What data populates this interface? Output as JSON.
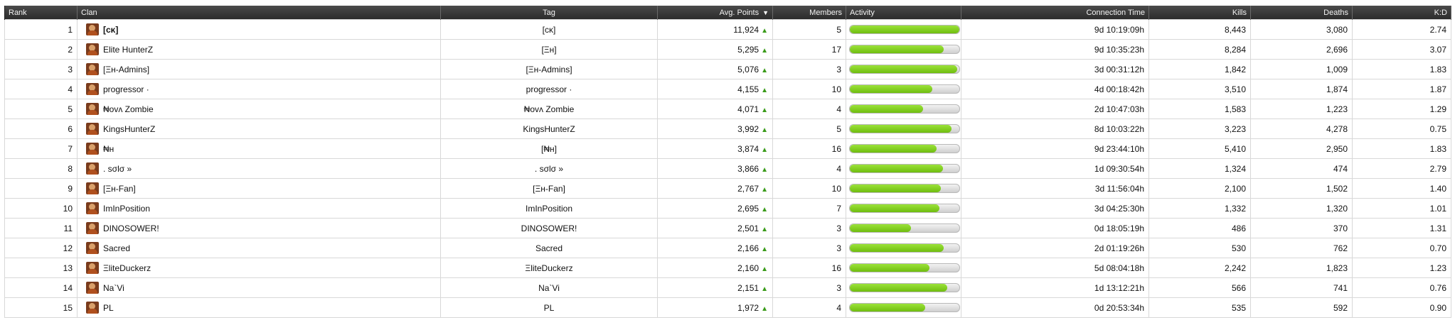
{
  "columns": {
    "rank": "Rank",
    "clan": "Clan",
    "tag": "Tag",
    "avg_points": "Avg. Points",
    "members": "Members",
    "activity": "Activity",
    "connection_time": "Connection Time",
    "kills": "Kills",
    "deaths": "Deaths",
    "kd": "K:D"
  },
  "sort_icon": "triangle-down-icon",
  "colors": {
    "header_bg": "#333333",
    "activity_bar": "#7ccf1c",
    "up_arrow": "#3a9b1a"
  },
  "rows": [
    {
      "rank": "1",
      "clan": "[ᴄᴋ]",
      "clan_bold": true,
      "tag": "[ᴄᴋ]",
      "avg_points": "11,924",
      "members": "5",
      "activity": 1.0,
      "connection_time": "9d 10:19:09h",
      "kills": "8,443",
      "deaths": "3,080",
      "kd": "2.74"
    },
    {
      "rank": "2",
      "clan": "Elite HunterZ",
      "tag": "[Ξн]",
      "avg_points": "5,295",
      "members": "17",
      "activity": 0.86,
      "connection_time": "9d 10:35:23h",
      "kills": "8,284",
      "deaths": "2,696",
      "kd": "3.07"
    },
    {
      "rank": "3",
      "clan": "[Ξн-Admins]",
      "tag": "[Ξн-Admins]",
      "avg_points": "5,076",
      "members": "3",
      "activity": 0.98,
      "connection_time": "3d 00:31:12h",
      "kills": "1,842",
      "deaths": "1,009",
      "kd": "1.83"
    },
    {
      "rank": "4",
      "clan": "progressor ·",
      "tag": "progressor ·",
      "avg_points": "4,155",
      "members": "10",
      "activity": 0.75,
      "connection_time": "4d 00:18:42h",
      "kills": "3,510",
      "deaths": "1,874",
      "kd": "1.87"
    },
    {
      "rank": "5",
      "clan": "₦ovʌ Zombie",
      "tag": "₦ovʌ Zombie",
      "avg_points": "4,071",
      "members": "4",
      "activity": 0.67,
      "connection_time": "2d 10:47:03h",
      "kills": "1,583",
      "deaths": "1,223",
      "kd": "1.29"
    },
    {
      "rank": "6",
      "clan": "KingsHunterZ",
      "tag": "KingsHunterZ",
      "avg_points": "3,992",
      "members": "5",
      "activity": 0.93,
      "connection_time": "8d 10:03:22h",
      "kills": "3,223",
      "deaths": "4,278",
      "kd": "0.75"
    },
    {
      "rank": "7",
      "clan": "₦н",
      "tag": "[₦н]",
      "avg_points": "3,874",
      "members": "16",
      "activity": 0.79,
      "connection_time": "9d 23:44:10h",
      "kills": "5,410",
      "deaths": "2,950",
      "kd": "1.83"
    },
    {
      "rank": "8",
      "clan": ". sσlσ »",
      "tag": ". sσlσ »",
      "avg_points": "3,866",
      "members": "4",
      "activity": 0.85,
      "connection_time": "1d 09:30:54h",
      "kills": "1,324",
      "deaths": "474",
      "kd": "2.79"
    },
    {
      "rank": "9",
      "clan": "[Ξн-Fan]",
      "tag": "[Ξн-Fan]",
      "avg_points": "2,767",
      "members": "10",
      "activity": 0.83,
      "connection_time": "3d 11:56:04h",
      "kills": "2,100",
      "deaths": "1,502",
      "kd": "1.40"
    },
    {
      "rank": "10",
      "clan": "ImInPosition",
      "tag": "ImInPosition",
      "avg_points": "2,695",
      "members": "7",
      "activity": 0.82,
      "connection_time": "3d 04:25:30h",
      "kills": "1,332",
      "deaths": "1,320",
      "kd": "1.01"
    },
    {
      "rank": "11",
      "clan": "DINOSOWER!",
      "tag": "DINOSOWER!",
      "avg_points": "2,501",
      "members": "3",
      "activity": 0.56,
      "connection_time": "0d 18:05:19h",
      "kills": "486",
      "deaths": "370",
      "kd": "1.31"
    },
    {
      "rank": "12",
      "clan": "Sacred",
      "tag": "Sacred",
      "avg_points": "2,166",
      "members": "3",
      "activity": 0.86,
      "connection_time": "2d 01:19:26h",
      "kills": "530",
      "deaths": "762",
      "kd": "0.70"
    },
    {
      "rank": "13",
      "clan": "ΞliteDuckerz",
      "tag": "ΞliteDuckerz",
      "avg_points": "2,160",
      "members": "16",
      "activity": 0.73,
      "connection_time": "5d 08:04:18h",
      "kills": "2,242",
      "deaths": "1,823",
      "kd": "1.23"
    },
    {
      "rank": "14",
      "clan": "Na`Vi",
      "tag": "Na`Vi",
      "avg_points": "2,151",
      "members": "3",
      "activity": 0.89,
      "connection_time": "1d 13:12:21h",
      "kills": "566",
      "deaths": "741",
      "kd": "0.76"
    },
    {
      "rank": "15",
      "clan": "PL",
      "tag": "PL",
      "avg_points": "1,972",
      "members": "4",
      "activity": 0.69,
      "connection_time": "0d 20:53:34h",
      "kills": "535",
      "deaths": "592",
      "kd": "0.90"
    }
  ]
}
